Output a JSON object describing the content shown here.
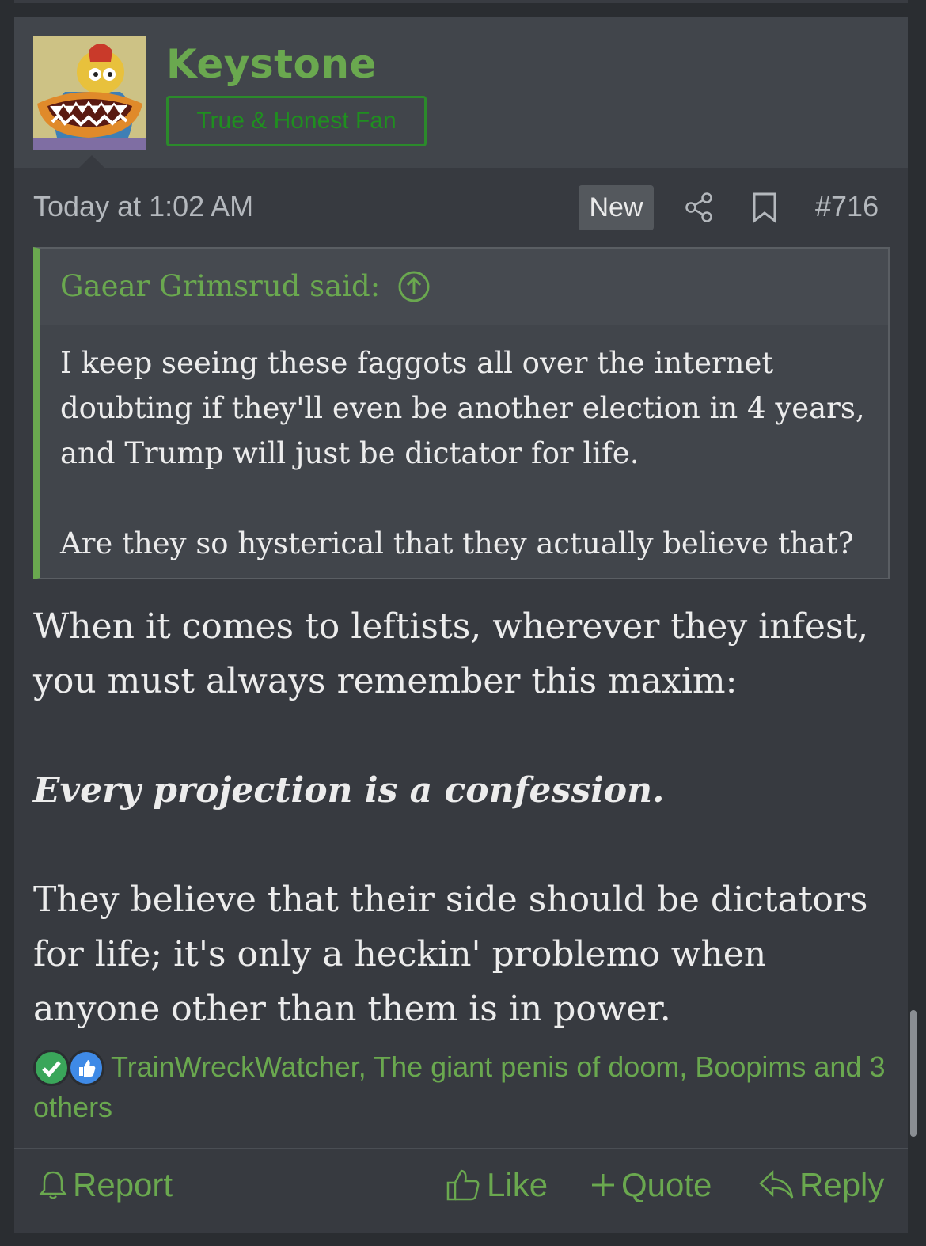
{
  "post": {
    "username": "Keystone",
    "user_title": "True & Honest Fan",
    "date": "Today at 1:02 AM",
    "new_badge": "New",
    "post_number": "#716",
    "quote": {
      "attribution": "Gaear Grimsrud said:",
      "paragraphs": [
        "I keep seeing these faggots all over the internet doubting if they'll even be another election in 4 years, and Trump will just be dictator for life.",
        "Are they so hysterical that they actually believe that?"
      ]
    },
    "body": {
      "p1": "When it comes to leftists, wherever they infest, you must always remember this maxim:",
      "p2": "Every projection is a confession.",
      "p3": "They believe that their side should be dictators for life; it's only a heckin' problemo when anyone other than them is in power."
    },
    "reactions": {
      "icons": [
        "checkmark-reaction-icon",
        "like-reaction-icon"
      ],
      "text": "TrainWreckWatcher, The giant penis of doom, Boopims and 3 others"
    },
    "actions": {
      "report": "Report",
      "like": "Like",
      "quote": "Quote",
      "reply": "Reply"
    }
  },
  "colors": {
    "accent_green": "#6aa84f",
    "title_border": "#2b8a2b",
    "post_bg": "#373a40",
    "header_bg": "#41454b"
  }
}
